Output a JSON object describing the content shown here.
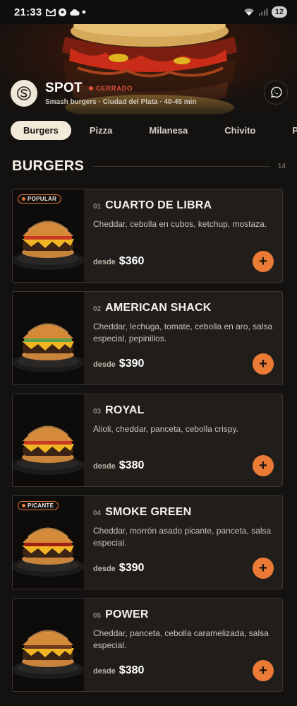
{
  "statusbar": {
    "time": "21:33",
    "battery": "12"
  },
  "brand": {
    "name": "SPOT",
    "status": "CERRADO",
    "subtitle": "Smash burgers · Ciudad del Plata · 40-45 min"
  },
  "tabs": [
    {
      "label": "Burgers",
      "active": true
    },
    {
      "label": "Pizza"
    },
    {
      "label": "Milanesa"
    },
    {
      "label": "Chivito"
    },
    {
      "label": "Postres"
    }
  ],
  "section": {
    "title": "BURGERS",
    "count": "14"
  },
  "products": [
    {
      "num": "01",
      "name": "CUARTO DE LIBRA",
      "desc": "Cheddar, cebolla en cubos, ketchup, mostaza.",
      "desde": "desde",
      "price": "$360",
      "badge": "POPULAR",
      "add": "+"
    },
    {
      "num": "02",
      "name": "AMERICAN SHACK",
      "desc": "Cheddar, lechuga, tomate, cebolla en aro, salsa especial, pepinillos.",
      "desde": "desde",
      "price": "$390",
      "badge": "",
      "add": "+"
    },
    {
      "num": "03",
      "name": "ROYAL",
      "desc": "Alioli, cheddar, panceta, cebolla crispy.",
      "desde": "desde",
      "price": "$380",
      "badge": "",
      "add": "+"
    },
    {
      "num": "04",
      "name": "SMOKE GREEN",
      "desc": "Cheddar, morrón asado picante, panceta, salsa especial.",
      "desde": "desde",
      "price": "$390",
      "badge": "PICANTE",
      "add": "+"
    },
    {
      "num": "05",
      "name": "POWER",
      "desc": "Cheddar, panceta, cebolla caramelizada, salsa especial.",
      "desde": "desde",
      "price": "$380",
      "badge": "",
      "add": "+"
    }
  ],
  "colors": {
    "accent": "#ea7a36",
    "closed": "#e1503e",
    "background": "#141210",
    "card": "#211d1a"
  },
  "icons": {
    "logo": "spot-logo-icon",
    "contact": "whatsapp-icon",
    "add": "plus-icon"
  }
}
